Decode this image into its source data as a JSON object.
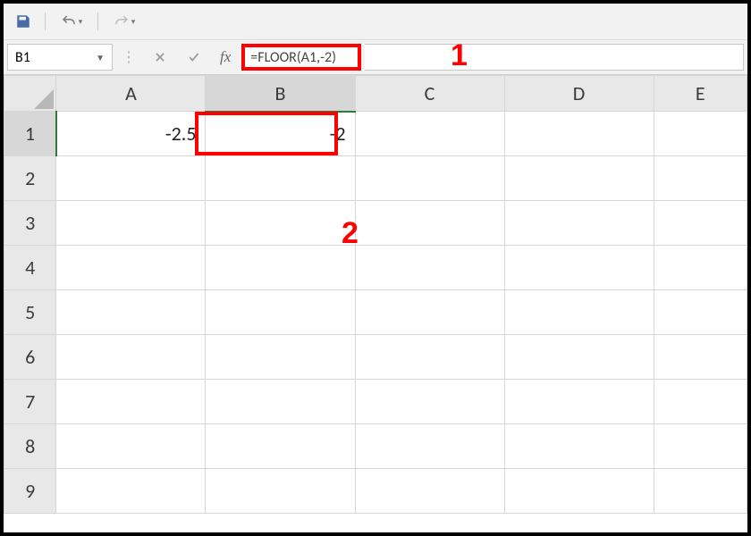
{
  "qat": {
    "save": "Save",
    "undo": "Undo",
    "redo": "Redo"
  },
  "formula_bar": {
    "name_box": "B1",
    "cancel": "Cancel",
    "enter": "Enter",
    "fx": "fx",
    "formula": "=FLOOR(A1,-2)"
  },
  "annotations": {
    "one": "1",
    "two": "2"
  },
  "columns": [
    "A",
    "B",
    "C",
    "D",
    "E"
  ],
  "rows": [
    "1",
    "2",
    "3",
    "4",
    "5",
    "6",
    "7",
    "8",
    "9"
  ],
  "selected_column": "B",
  "selected_row": "1",
  "cells": {
    "A1": "-2.5",
    "B1": "-2"
  },
  "chart_data": {
    "type": "table",
    "columns": [
      "A",
      "B",
      "C",
      "D",
      "E"
    ],
    "data": [
      {
        "A": -2.5,
        "B": -2
      }
    ],
    "formula_B1": "=FLOOR(A1,-2)"
  }
}
